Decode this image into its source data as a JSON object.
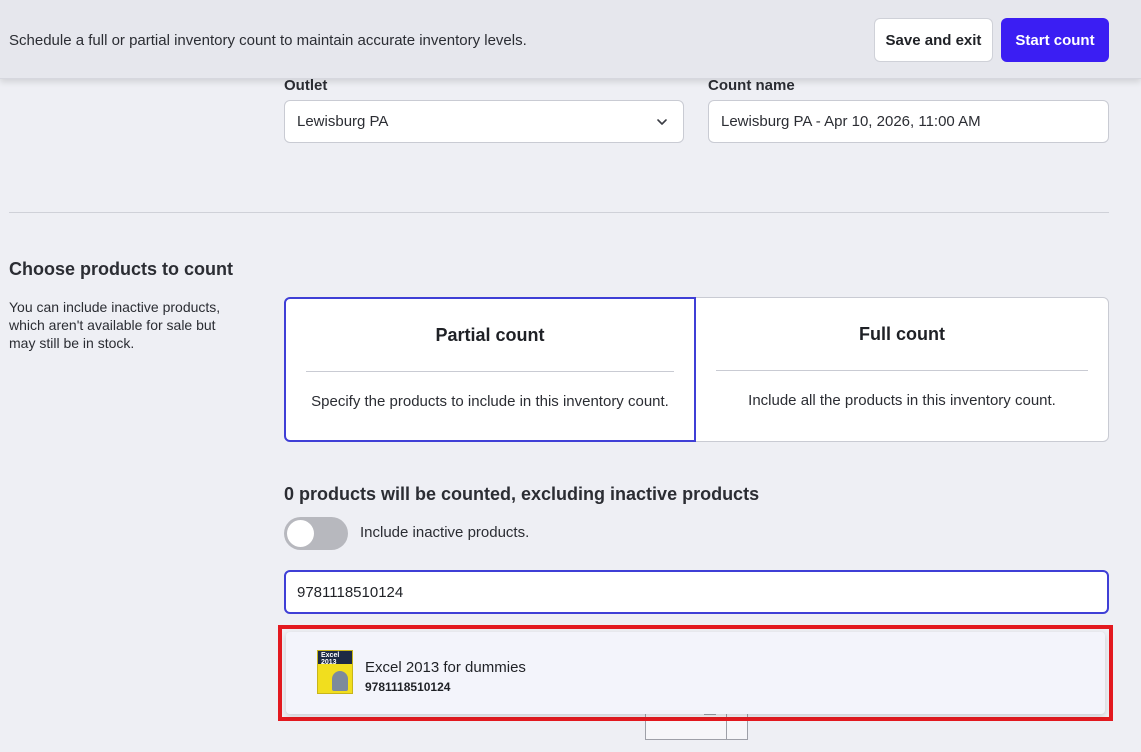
{
  "header": {
    "description": "Schedule a full or partial inventory count to maintain accurate inventory levels.",
    "save_exit_label": "Save and exit",
    "start_count_label": "Start count"
  },
  "form": {
    "outlet_label": "Outlet",
    "outlet_value": "Lewisburg PA",
    "count_name_label": "Count name",
    "count_name_value": "Lewisburg PA - Apr 10, 2026, 11:00 AM"
  },
  "products_section": {
    "title": "Choose products to count",
    "description": "You can include inactive products, which aren't available for sale but may still be in stock.",
    "options": [
      {
        "title": "Partial count",
        "description": "Specify the products to include in this inventory count.",
        "selected": true
      },
      {
        "title": "Full count",
        "description": "Include all the products in this inventory count.",
        "selected": false
      }
    ],
    "count_summary": "0 products will be counted, excluding inactive products",
    "toggle_label": "Include inactive products.",
    "toggle_on": false,
    "search_value": "9781118510124"
  },
  "search_results": [
    {
      "name": "Excel 2013 for dummies",
      "sku": "9781118510124",
      "thumbnail_text": "Excel 2013"
    }
  ],
  "colors": {
    "accent": "#3b1ef3",
    "highlight": "#e3191f"
  }
}
